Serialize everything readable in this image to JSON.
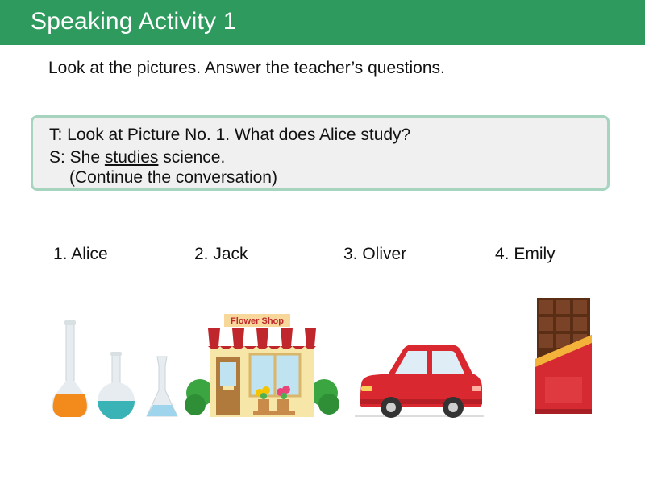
{
  "header": {
    "title": "Speaking Activity 1"
  },
  "instruction": "Look at the pictures. Answer the teacher’s questions.",
  "dialogue": {
    "teacher_line": "T: Look at Picture No. 1. What does Alice study?",
    "student_prefix": "S: She",
    "student_underlined": "studies",
    "student_suffix": "science.",
    "continue_note": "(Continue the conversation)"
  },
  "pictures": [
    {
      "label": "1. Alice",
      "icon": "lab-flasks-icon"
    },
    {
      "label": "2. Jack",
      "icon": "flower-shop-icon",
      "sign": "Flower Shop"
    },
    {
      "label": "3. Oliver",
      "icon": "red-car-icon"
    },
    {
      "label": "4. Emily",
      "icon": "chocolate-bar-icon"
    }
  ],
  "colors": {
    "header_bg": "#2e9a5e",
    "box_border": "#a6d4bf",
    "box_bg": "#f0f0f0"
  }
}
